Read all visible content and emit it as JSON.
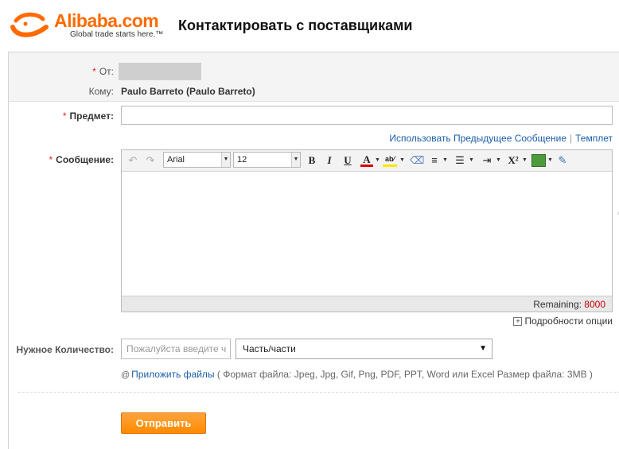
{
  "header": {
    "brand": "Alibaba.com",
    "tagline": "Global trade starts here.™",
    "page_title": "Контактировать с поставщиками"
  },
  "form": {
    "from_label": "От:",
    "to_label": "Кому:",
    "to_value": "Paulo Barreto (Paulo Barreto)",
    "subject_label": "Предмет:",
    "subject_value": "",
    "use_previous_link": "Использовать Предыдущее Сообщение",
    "template_link": "Темплет",
    "message_label": "Сообщение:",
    "required_mark": "*",
    "editor": {
      "font_value": "Arial",
      "size_value": "12",
      "remaining_label": "Remaining:",
      "remaining_count": "8000"
    },
    "details_link": "Подробности опции",
    "quantity_label": "Нужное Количество:",
    "quantity_placeholder": "Пожалуйста введите ч",
    "unit_value": "Часть/части",
    "attach_link": "Приложить файлы",
    "attach_note": "( Формат файла: Jpeg, Jpg, Gif, Png, PDF, PPT, Word или Excel Размер файла: 3MB )",
    "send_label": "Отправить"
  },
  "colors": {
    "brand_orange": "#ff6a00",
    "link_blue": "#1a5ea8",
    "required_red": "#e02020",
    "button_orange": "#ff9a1f"
  }
}
